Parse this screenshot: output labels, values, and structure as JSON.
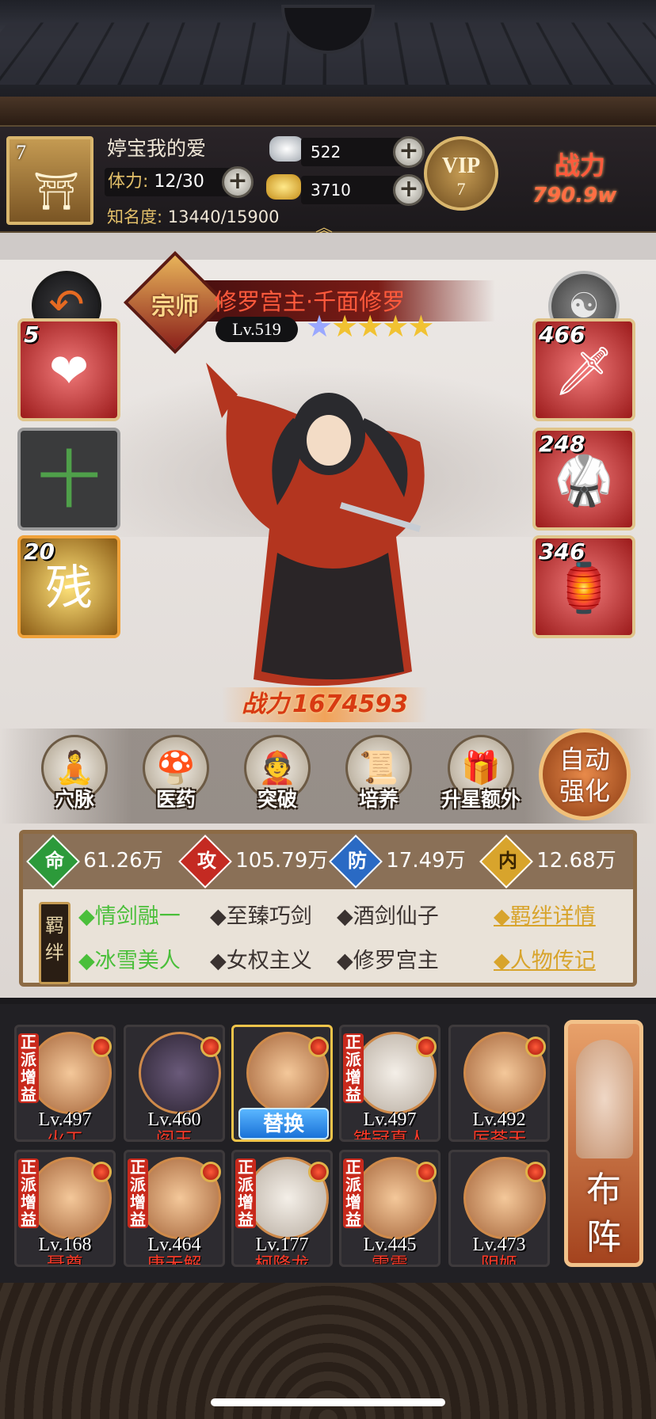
{
  "header": {
    "player_level": "7",
    "player_name": "婷宝我的爱",
    "stamina_label": "体力:",
    "stamina_value": "12/30",
    "fame_label": "知名度:",
    "fame_value": "13440/15900",
    "silver": "522",
    "gold": "3710",
    "vip_label": "VIP",
    "vip_level": "7",
    "power_label": "战力",
    "power_value": "790.9w"
  },
  "hero": {
    "rank": "宗师",
    "name": "修罗宫主·千面修罗",
    "level": "Lv.519",
    "stars": 5,
    "combat_power_label": "战力",
    "combat_power_value": "1674593"
  },
  "slots": {
    "left": [
      {
        "count": "5",
        "type": "red"
      },
      {
        "count": "",
        "type": "gray"
      },
      {
        "count": "20",
        "type": "gold",
        "label": "残"
      }
    ],
    "right": [
      {
        "count": "466",
        "type": "red"
      },
      {
        "count": "248",
        "type": "red"
      },
      {
        "count": "346",
        "type": "red"
      }
    ]
  },
  "functions": [
    "穴脉",
    "医药",
    "突破",
    "培养",
    "升星额外"
  ],
  "auto_enhance": [
    "自动",
    "强化"
  ],
  "stats": [
    {
      "icon": "命",
      "value": "61.26万"
    },
    {
      "icon": "攻",
      "value": "105.79万"
    },
    {
      "icon": "防",
      "value": "17.49万"
    },
    {
      "icon": "内",
      "value": "12.68万"
    }
  ],
  "bond_tag": "羁绊",
  "bonds_row1": [
    "情剑融一",
    "至臻巧剑",
    "酒剑仙子"
  ],
  "bonds_row2": [
    "冰雪美人",
    "女权主义",
    "修罗宫主"
  ],
  "bond_links": [
    "羁绊详情",
    "人物传记"
  ],
  "roster": [
    {
      "lv": "Lv.497",
      "name": "火工",
      "tag": "正派增益"
    },
    {
      "lv": "Lv.460",
      "name": "阎王",
      "tag": ""
    },
    {
      "lv": "",
      "name": "",
      "tag": "",
      "swap": "替换"
    },
    {
      "lv": "Lv.497",
      "name": "铁冠真人",
      "tag": "正派增益"
    },
    {
      "lv": "Lv.492",
      "name": "厉苍天",
      "tag": ""
    },
    {
      "lv": "Lv.168",
      "name": "聂尊",
      "tag": "正派增益"
    },
    {
      "lv": "Lv.464",
      "name": "唐无解",
      "tag": "正派增益"
    },
    {
      "lv": "Lv.177",
      "name": "柯降龙",
      "tag": "正派增益"
    },
    {
      "lv": "Lv.445",
      "name": "雷震",
      "tag": "正派增益"
    },
    {
      "lv": "Lv.473",
      "name": "阴姬",
      "tag": ""
    }
  ],
  "formation_label": [
    "布",
    "阵"
  ]
}
